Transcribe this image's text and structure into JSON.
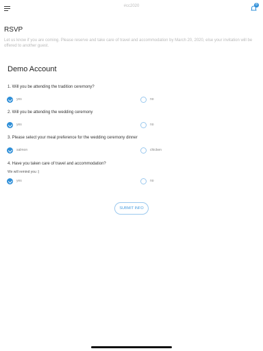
{
  "header": {
    "app_title": "#cc2020",
    "notification_count": "8"
  },
  "page": {
    "title": "RSVP",
    "intro": "Let us know if you are coming. Please reserve and take care of travel and accommodation by March 20, 2020, else your invitation will be offered to another guest.",
    "account_name": "Demo Account"
  },
  "questions": [
    {
      "text": "1. Will you be attending the tradition ceremony?",
      "hint": "",
      "options": [
        {
          "label": "yes",
          "selected": true
        },
        {
          "label": "no",
          "selected": false
        }
      ]
    },
    {
      "text": "2. Will you be attending the wedding ceremony",
      "hint": "",
      "options": [
        {
          "label": "yes",
          "selected": true
        },
        {
          "label": "no",
          "selected": false
        }
      ]
    },
    {
      "text": "3. Please select your meal preference for the wedding ceremony dinner",
      "hint": "",
      "options": [
        {
          "label": "salmon",
          "selected": true
        },
        {
          "label": "chicken",
          "selected": false
        }
      ]
    },
    {
      "text": "4. Have you taken care of travel and accommodation?",
      "hint": "We will remind you :)",
      "options": [
        {
          "label": "yes",
          "selected": true
        },
        {
          "label": "no",
          "selected": false
        }
      ]
    }
  ],
  "submit_label": "SUBMIT INFO",
  "icons": {
    "menu": "hamburger-icon",
    "notifications": "bell-icon",
    "checked": "checkmark-icon"
  },
  "colors": {
    "accent": "#2f8fd8",
    "radio_border": "#9ac8ee",
    "muted_text": "#b8b8b8"
  }
}
